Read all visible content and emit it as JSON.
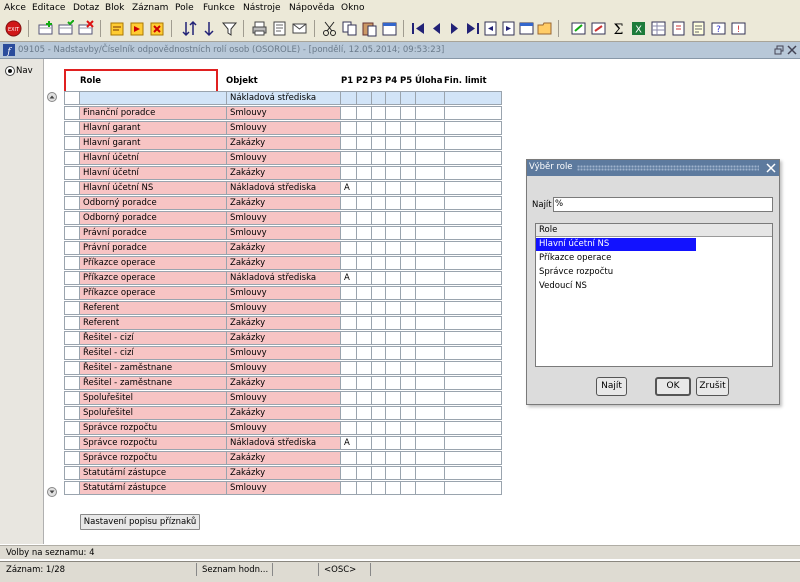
{
  "menu": [
    "Akce",
    "Editace",
    "Dotaz",
    "Blok",
    "Záznam",
    "Pole",
    "Funkce",
    "Nástroje",
    "Nápověda",
    "Okno"
  ],
  "window_title": "09105 - Nadstavby/Číselník odpovědnostních rolí osob (OSOROLE) - [pondělí, 12.05.2014; 09:53:23]",
  "nav_label": "Nav",
  "columns": {
    "role": "Role",
    "objekt": "Objekt",
    "p1": "P1",
    "p2": "P2",
    "p3": "P3",
    "p4": "P4",
    "p5": "P5",
    "uloha": "Úloha",
    "fin_limit": "Fin. limit"
  },
  "rows": [
    {
      "role": "",
      "objekt": "Nákladová střediska",
      "p1": ""
    },
    {
      "role": "Finanční poradce",
      "objekt": "Smlouvy",
      "p1": ""
    },
    {
      "role": "Hlavní garant",
      "objekt": "Smlouvy",
      "p1": ""
    },
    {
      "role": "Hlavní garant",
      "objekt": "Zakázky",
      "p1": ""
    },
    {
      "role": "Hlavní účetní",
      "objekt": "Smlouvy",
      "p1": ""
    },
    {
      "role": "Hlavní účetní",
      "objekt": "Zakázky",
      "p1": ""
    },
    {
      "role": "Hlavní účetní NS",
      "objekt": "Nákladová střediska",
      "p1": "A"
    },
    {
      "role": "Odborný poradce",
      "objekt": "Zakázky",
      "p1": ""
    },
    {
      "role": "Odborný poradce",
      "objekt": "Smlouvy",
      "p1": ""
    },
    {
      "role": "Právní poradce",
      "objekt": "Smlouvy",
      "p1": ""
    },
    {
      "role": "Právní poradce",
      "objekt": "Zakázky",
      "p1": ""
    },
    {
      "role": "Příkazce operace",
      "objekt": "Zakázky",
      "p1": ""
    },
    {
      "role": "Příkazce operace",
      "objekt": "Nákladová střediska",
      "p1": "A"
    },
    {
      "role": "Příkazce operace",
      "objekt": "Smlouvy",
      "p1": ""
    },
    {
      "role": "Referent",
      "objekt": "Smlouvy",
      "p1": ""
    },
    {
      "role": "Referent",
      "objekt": "Zakázky",
      "p1": ""
    },
    {
      "role": "Řešitel - cizí",
      "objekt": "Zakázky",
      "p1": ""
    },
    {
      "role": "Řešitel - cizí",
      "objekt": "Smlouvy",
      "p1": ""
    },
    {
      "role": "Řešitel - zaměstnane",
      "objekt": "Smlouvy",
      "p1": ""
    },
    {
      "role": "Řešitel - zaměstnane",
      "objekt": "Zakázky",
      "p1": ""
    },
    {
      "role": "Spoluřešitel",
      "objekt": "Smlouvy",
      "p1": ""
    },
    {
      "role": "Spoluřešitel",
      "objekt": "Zakázky",
      "p1": ""
    },
    {
      "role": "Správce rozpočtu",
      "objekt": "Smlouvy",
      "p1": ""
    },
    {
      "role": "Správce rozpočtu",
      "objekt": "Nákladová střediska",
      "p1": "A"
    },
    {
      "role": "Správce rozpočtu",
      "objekt": "Zakázky",
      "p1": ""
    },
    {
      "role": "Statutární zástupce",
      "objekt": "Zakázky",
      "p1": ""
    },
    {
      "role": "Statutární zástupce",
      "objekt": "Smlouvy",
      "p1": ""
    }
  ],
  "settings_button": "Nastavení popisu příznaků",
  "dialog": {
    "title": "Výběr role",
    "find_label": "Najít",
    "find_value": "%",
    "list_header": "Role",
    "items": [
      "Hlavní účetní NS",
      "Příkazce operace",
      "Správce rozpočtu",
      "Vedoucí NS"
    ],
    "btn_find": "Najít",
    "btn_ok": "OK",
    "btn_cancel": "Zrušit"
  },
  "status": {
    "message": "Volby na seznamu: 4",
    "record": "Záznam: 1/28",
    "list": "Seznam hodn...",
    "mode": "<OSC>"
  },
  "colors": {
    "required": "#f7c4c4",
    "selected": "#1212ff",
    "current_row": "#d2e4f7",
    "highlight_box": "#e02020"
  }
}
